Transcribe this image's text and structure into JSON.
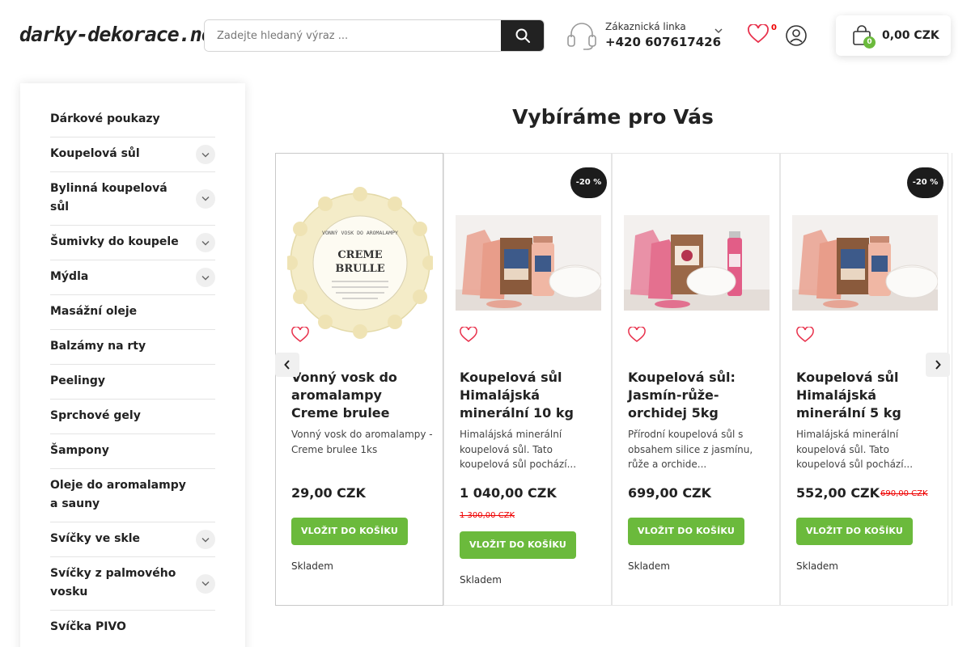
{
  "header": {
    "logo_text": "darky-dekorace.net",
    "search_placeholder": "Zadejte hledaný výraz ...",
    "hotline_label": "Zákaznická linka",
    "hotline_phone": "+420 607617426",
    "wishlist_count": "0",
    "cart_count": "0",
    "cart_total": "0,00 CZK",
    "accent_color": "#6bba3c"
  },
  "sidebar": {
    "items": [
      {
        "label": "Dárkové poukazy",
        "has_children": false
      },
      {
        "label": "Koupelová sůl",
        "has_children": true
      },
      {
        "label": "Bylinná koupelová sůl",
        "has_children": true
      },
      {
        "label": "Šumivky do koupele",
        "has_children": true
      },
      {
        "label": "Mýdla",
        "has_children": true
      },
      {
        "label": "Masážní oleje",
        "has_children": false
      },
      {
        "label": "Balzámy na rty",
        "has_children": false
      },
      {
        "label": "Peelingy",
        "has_children": false
      },
      {
        "label": "Sprchové gely",
        "has_children": false
      },
      {
        "label": "Šampony",
        "has_children": false
      },
      {
        "label": "Oleje do aromalampy a sauny",
        "has_children": false
      },
      {
        "label": "Svíčky ve skle",
        "has_children": true
      },
      {
        "label": "Svíčky z palmového vosku",
        "has_children": true
      },
      {
        "label": "Svíčka PIVO",
        "has_children": false
      }
    ]
  },
  "main": {
    "section_title": "Vybíráme pro Vás",
    "products": [
      {
        "name": "Vonný vosk do aromalampy Creme brulee",
        "description": "Vonný vosk do aromalampy - Creme brulee 1ks",
        "price": "29,00 CZK",
        "old_price": "",
        "badge": "",
        "cta": "VLOŽIT DO KOŠÍKU",
        "stock": "Skladem",
        "image_lines": [
          "VONNÝ VOSK DO AROMALAMPY",
          "CREME",
          "BRULLE"
        ]
      },
      {
        "name": "Koupelová sůl Himalájská minerální 10 kg",
        "description": "Himalájská minerální koupelová sůl. Tato koupelová sůl pochází...",
        "price": "1 040,00 CZK",
        "old_price": "1 300,00 CZK",
        "badge": "-20 %",
        "cta": "VLOŽIT DO KOŠÍKU",
        "stock": "Skladem"
      },
      {
        "name": "Koupelová sůl: Jasmín-růže-orchidej 5kg",
        "description": "Přírodní koupelová sůl s obsahem silice z jasmínu, růže a orchide...",
        "price": "699,00 CZK",
        "old_price": "",
        "badge": "",
        "cta": "VLOŽIT DO KOŠÍKU",
        "stock": "Skladem"
      },
      {
        "name": "Koupelová sůl Himalájská minerální 5 kg",
        "description": "Himalájská minerální koupelová sůl. Tato koupelová sůl pochází...",
        "price": "552,00 CZK",
        "old_price": "690,00 CZK",
        "badge": "-20 %",
        "cta": "VLOŽIT DO KOŠÍKU",
        "stock": "Skladem"
      }
    ]
  }
}
